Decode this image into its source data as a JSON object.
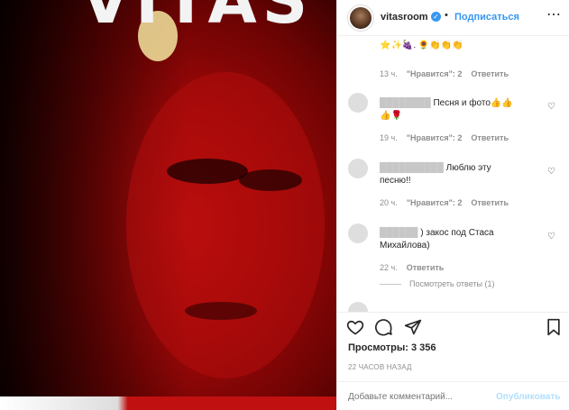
{
  "header": {
    "username": "vitasroom",
    "verified_symbol": "✓",
    "separator": "•",
    "follow_label": "Подписаться",
    "more_label": "⋯"
  },
  "media": {
    "title_top": "VITAS"
  },
  "comments": [
    {
      "text": "⭐✨🍇. 🌻👏👏👏",
      "time": "13 ч.",
      "likes": "\"Нравится\": 2",
      "reply": "Ответить"
    },
    {
      "text": "Песня и фото👍👍",
      "text2": "👍🌹",
      "time": "19 ч.",
      "likes": "\"Нравится\": 2",
      "reply": "Ответить"
    },
    {
      "text": "Люблю эту",
      "text2": "песню!!",
      "time": "20 ч.",
      "likes": "\"Нравится\": 2",
      "reply": "Ответить"
    },
    {
      "text": ") закос под Стаса",
      "text2": "Михайлова)",
      "time": "22 ч.",
      "reply": "Ответить",
      "view_replies": "Посмотреть ответы (1)"
    }
  ],
  "stats": {
    "views": "Просмотры: 3 356",
    "posted": "22 ЧАСОВ НАЗАД"
  },
  "composer": {
    "placeholder": "Добавьте комментарий...",
    "post_label": "Опубликовать"
  },
  "icons": {
    "like": "heart-icon",
    "comment": "comment-icon",
    "share": "share-icon",
    "save": "bookmark-icon"
  }
}
